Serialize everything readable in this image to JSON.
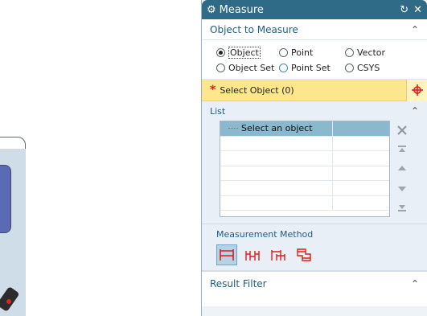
{
  "dialog": {
    "title": "Measure",
    "title_buttons": [
      "↻",
      "✕"
    ]
  },
  "object_to_measure": {
    "header": "Object to Measure",
    "radios": [
      {
        "label": "Object",
        "checked": true
      },
      {
        "label": "Point",
        "checked": false
      },
      {
        "label": "Vector",
        "checked": false
      },
      {
        "label": "Object Set",
        "checked": false
      },
      {
        "label": "Point Set",
        "checked": false
      },
      {
        "label": "CSYS",
        "checked": false
      }
    ],
    "select_label": "Select Object (0)"
  },
  "list": {
    "header": "List",
    "rows": [
      {
        "name": "Select an object",
        "value": ""
      },
      {
        "name": "",
        "value": ""
      },
      {
        "name": "",
        "value": ""
      },
      {
        "name": "",
        "value": ""
      },
      {
        "name": "",
        "value": ""
      },
      {
        "name": "",
        "value": ""
      }
    ]
  },
  "measurement_method": {
    "label": "Measurement Method"
  },
  "result_filter": {
    "header": "Result Filter"
  },
  "colors": {
    "titlebar": "#2f6a86",
    "highlight": "#fde68c",
    "selected_row": "#8ab8cf",
    "accent_red": "#e11b1b"
  }
}
